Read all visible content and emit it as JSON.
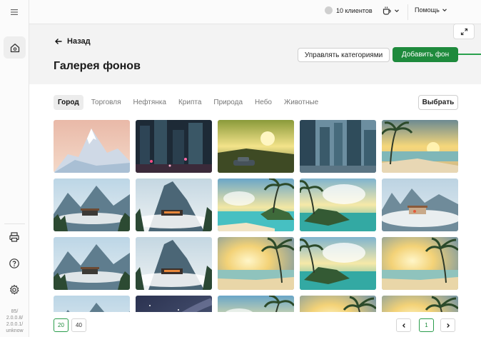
{
  "topbar": {
    "clients_label": "10 клиентов",
    "help_label": "Помощь"
  },
  "sidebar": {
    "version_lines": [
      "85/",
      "2.0.0.8/",
      "2.0.0.1/",
      "unknow"
    ]
  },
  "header": {
    "back_label": "Назад",
    "title": "Галерея фонов",
    "manage_categories_label": "Управлять категориями",
    "add_background_label": "Добавить фон"
  },
  "tabs": [
    {
      "label": "Город",
      "active": true
    },
    {
      "label": "Торговля",
      "active": false
    },
    {
      "label": "Нефтянка",
      "active": false
    },
    {
      "label": "Крипта",
      "active": false
    },
    {
      "label": "Природа",
      "active": false
    },
    {
      "label": "Небо",
      "active": false
    },
    {
      "label": "Животные",
      "active": false
    }
  ],
  "select_label": "Выбрать",
  "pagination": {
    "page_sizes": [
      "20",
      "40"
    ],
    "active_page_size": "20",
    "current_page": "1"
  },
  "gallery": [
    "snowy-mountain",
    "neon-city",
    "car-sunset",
    "city-towers",
    "beach-palm",
    "mountain-lodge",
    "mountain-house",
    "tropical-island",
    "island-palms",
    "cliff-house",
    "mountain-lodge",
    "mountain-house",
    "sunset-palms",
    "island-palms",
    "sunset-palms",
    "mountain-lodge",
    "night-sky",
    "tropical-island",
    "sunset-palms",
    "sunset-palms"
  ],
  "colors": {
    "accent": "#1e8a3c",
    "page_bg": "#f3f3f3",
    "panel_bg": "#ffffff"
  }
}
